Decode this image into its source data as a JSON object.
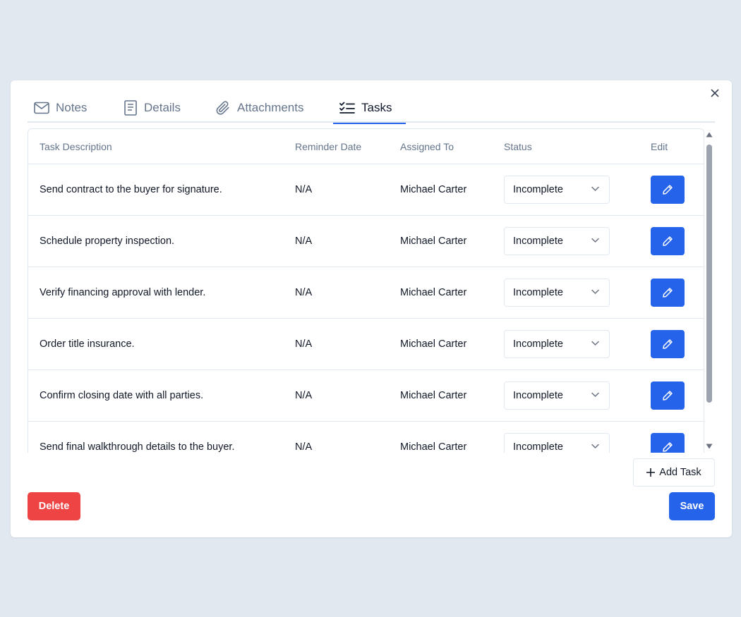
{
  "colors": {
    "primary": "#2563eb",
    "danger": "#ef4444",
    "background": "#e2e8f0",
    "muted_text": "#64748b"
  },
  "tabs": [
    {
      "label": "Notes",
      "icon": "envelope-icon",
      "active": false
    },
    {
      "label": "Details",
      "icon": "document-icon",
      "active": false
    },
    {
      "label": "Attachments",
      "icon": "paperclip-icon",
      "active": false
    },
    {
      "label": "Tasks",
      "icon": "checklist-icon",
      "active": true
    }
  ],
  "table": {
    "headers": [
      "Task Description",
      "Reminder Date",
      "Assigned To",
      "Status",
      "Edit"
    ],
    "rows": [
      {
        "description": "Send contract to the buyer for signature.",
        "reminder": "N/A",
        "assigned": "Michael Carter",
        "status": "Incomplete"
      },
      {
        "description": "Schedule property inspection.",
        "reminder": "N/A",
        "assigned": "Michael Carter",
        "status": "Incomplete"
      },
      {
        "description": "Verify financing approval with lender.",
        "reminder": "N/A",
        "assigned": "Michael Carter",
        "status": "Incomplete"
      },
      {
        "description": "Order title insurance.",
        "reminder": "N/A",
        "assigned": "Michael Carter",
        "status": "Incomplete"
      },
      {
        "description": "Confirm closing date with all parties.",
        "reminder": "N/A",
        "assigned": "Michael Carter",
        "status": "Incomplete"
      },
      {
        "description": "Send final walkthrough details to the buyer.",
        "reminder": "N/A",
        "assigned": "Michael Carter",
        "status": "Incomplete"
      }
    ]
  },
  "actions": {
    "add_task": "Add Task",
    "delete": "Delete",
    "save": "Save"
  }
}
